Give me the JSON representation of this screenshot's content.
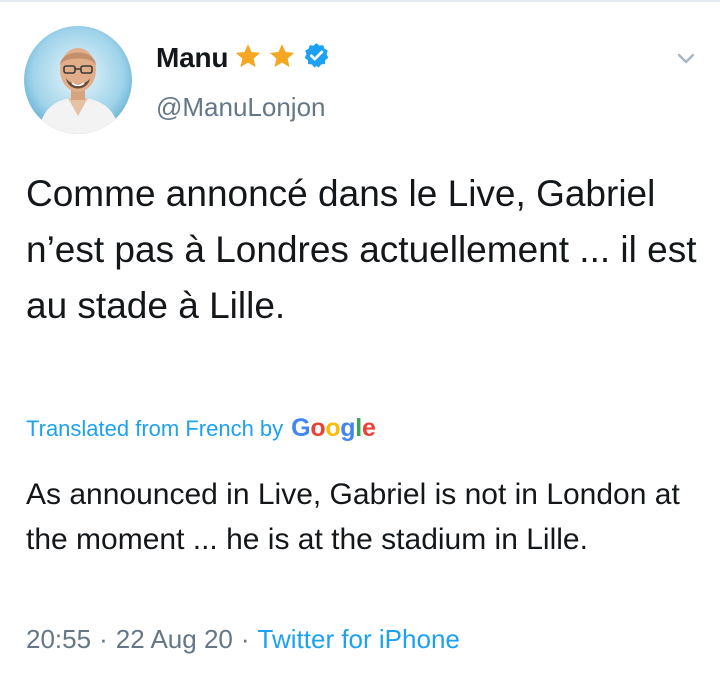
{
  "tweet": {
    "display_name": "Manu",
    "handle": "@ManuLonjon",
    "badges": [
      "star-icon",
      "star-icon",
      "verified-badge-icon"
    ],
    "text": "Comme annoncé dans le Live, Gabriel n’est pas à Londres actuellement ... il est au stade à Lille.",
    "translated_label": "Translated from French by",
    "translation_provider": [
      "G",
      "o",
      "o",
      "g",
      "l",
      "e"
    ],
    "translation": "As announced in Live, Gabriel is not in London at the moment ... he is at the stadium in Lille.",
    "time": "20:55",
    "separator": "·",
    "date": "22 Aug 20",
    "source": "Twitter for iPhone"
  },
  "colors": {
    "link": "#1da1f2",
    "secondary_text": "#657786",
    "star": "#f5a623",
    "verified": "#1da1f2",
    "google": [
      "#4285f4",
      "#ea4335",
      "#fbbc05",
      "#4285f4",
      "#34a853",
      "#ea4335"
    ]
  }
}
